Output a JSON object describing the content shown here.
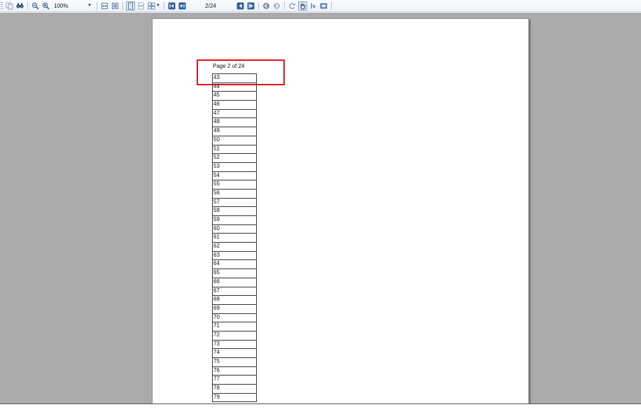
{
  "toolbar": {
    "zoom_value": "100%",
    "page_indicator": "2/24",
    "icons": [
      "copy-icon",
      "find-icon",
      "zoom-out-icon",
      "zoom-in-icon",
      "fit-width-icon",
      "fit-page-icon",
      "single-page-icon",
      "continuous-page-icon",
      "multi-page-icon",
      "previous-page-icon",
      "next-page-icon",
      "first-page-icon",
      "last-page-icon",
      "back-icon",
      "forward-icon",
      "refresh-icon",
      "pan-hand-icon",
      "select-text-icon",
      "snapshot-icon"
    ]
  },
  "document": {
    "page_header": "Page 2 of 24",
    "rows": [
      "43",
      "44",
      "45",
      "46",
      "47",
      "48",
      "49",
      "50",
      "51",
      "52",
      "53",
      "54",
      "55",
      "56",
      "57",
      "58",
      "59",
      "60",
      "61",
      "62",
      "63",
      "64",
      "65",
      "66",
      "67",
      "68",
      "69",
      "70",
      "71",
      "72",
      "73",
      "74",
      "75",
      "76",
      "77",
      "78",
      "79"
    ]
  },
  "colors": {
    "viewer_background": "#ababab",
    "highlight": "#e0141c",
    "toolbar_border": "#c9d3e2"
  }
}
